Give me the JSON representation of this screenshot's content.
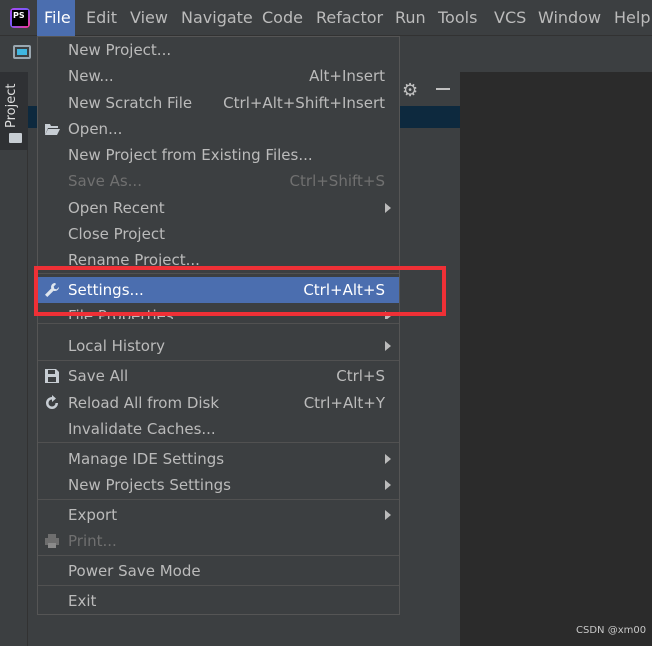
{
  "menubar": {
    "logo_text": "PS",
    "items": [
      {
        "label": "File",
        "mnemonic": "F"
      },
      {
        "label": "Edit",
        "mnemonic": "E"
      },
      {
        "label": "View",
        "mnemonic": "V"
      },
      {
        "label": "Navigate",
        "mnemonic": "N"
      },
      {
        "label": "Code",
        "mnemonic": "C"
      },
      {
        "label": "Refactor",
        "mnemonic": "R"
      },
      {
        "label": "Run",
        "mnemonic": "u"
      },
      {
        "label": "Tools",
        "mnemonic": "T"
      },
      {
        "label": "VCS",
        "mnemonic": "S"
      },
      {
        "label": "Window",
        "mnemonic": "W"
      },
      {
        "label": "Help",
        "mnemonic": "H"
      }
    ]
  },
  "sidebar": {
    "project_tab": "Project"
  },
  "file_menu": {
    "items": [
      {
        "label": "New Project...",
        "shortcut": ""
      },
      {
        "label": "New...",
        "shortcut": "Alt+Insert"
      },
      {
        "label": "New Scratch File",
        "shortcut": "Ctrl+Alt+Shift+Insert"
      },
      {
        "label": "Open...",
        "shortcut": "",
        "icon": "folder-open-icon"
      },
      {
        "label": "New Project from Existing Files...",
        "shortcut": ""
      },
      {
        "label": "Save As...",
        "shortcut": "Ctrl+Shift+S",
        "disabled": true
      },
      {
        "label": "Open Recent",
        "shortcut": "",
        "submenu": true
      },
      {
        "label": "Close Project",
        "shortcut": ""
      },
      {
        "label": "Rename Project...",
        "shortcut": ""
      },
      {
        "label": "Settings...",
        "shortcut": "Ctrl+Alt+S",
        "icon": "wrench-icon",
        "highlighted": true
      },
      {
        "label": "File Properties",
        "shortcut": "",
        "submenu": true
      },
      {
        "label": "Local History",
        "shortcut": "",
        "submenu": true
      },
      {
        "label": "Save All",
        "shortcut": "Ctrl+S",
        "icon": "floppy-disk-icon"
      },
      {
        "label": "Reload All from Disk",
        "shortcut": "Ctrl+Alt+Y",
        "icon": "reload-icon"
      },
      {
        "label": "Invalidate Caches...",
        "shortcut": ""
      },
      {
        "label": "Manage IDE Settings",
        "shortcut": "",
        "submenu": true
      },
      {
        "label": "New Projects Settings",
        "shortcut": "",
        "submenu": true
      },
      {
        "label": "Export",
        "shortcut": "",
        "submenu": true
      },
      {
        "label": "Print...",
        "shortcut": "",
        "icon": "printer-icon",
        "disabled": true
      },
      {
        "label": "Power Save Mode",
        "shortcut": ""
      },
      {
        "label": "Exit",
        "shortcut": ""
      }
    ]
  },
  "annotation": {
    "highlight_color": "#ef3036"
  },
  "watermark": "CSDN @xm00"
}
